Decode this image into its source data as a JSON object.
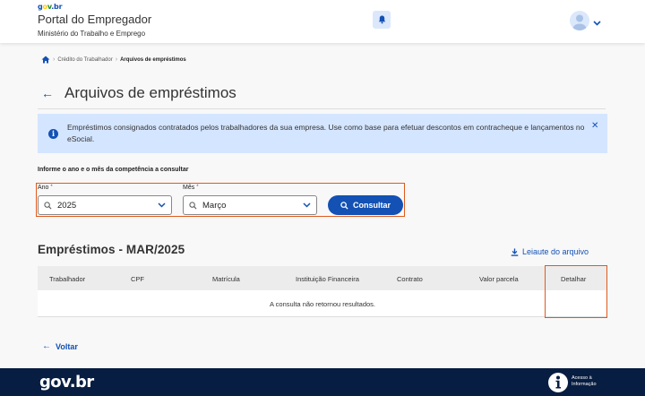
{
  "header": {
    "logo_small": {
      "g": "g",
      "o": "o",
      "v": "v",
      "b": ".br"
    },
    "title": "Portal do Empregador",
    "subtitle": "Ministério do Trabalho e Emprego",
    "bell_icon": "bell-icon",
    "avatar_icon": "user-avatar-icon"
  },
  "breadcrumb": {
    "home_icon": "home-icon",
    "items": [
      "Crédito do Trabalhador",
      "Arquivos de empréstimos"
    ]
  },
  "page": {
    "title": "Arquivos de empréstimos"
  },
  "alert": {
    "text": "Empréstimos consignados contratados pelos trabalhadores da sua empresa. Use como base para efetuar descontos em contracheque e lançamentos no eSocial.",
    "icon_glyph": "i",
    "close_glyph": "✕"
  },
  "filters": {
    "label": "Informe o ano e o mês da competência a consultar",
    "year": {
      "label": "Ano",
      "required_mark": "*",
      "value": "2025"
    },
    "month": {
      "label": "Mês",
      "required_mark": "*",
      "value": "Março"
    },
    "submit_label": "Consultar"
  },
  "results": {
    "title": "Empréstimos - MAR/2025",
    "layout_link": "Leiaute do arquivo",
    "columns": [
      "Trabalhador",
      "CPF",
      "Matrícula",
      "Instituição Financeira",
      "Contrato",
      "Valor parcela",
      "Detalhar"
    ],
    "empty_message": "A consulta não retornou resultados."
  },
  "back_link": "Voltar",
  "footer": {
    "logo": "gov.br",
    "access_label": "Acesso à Informação"
  },
  "colors": {
    "primary": "#1351b4",
    "footer_bg": "#071d41",
    "alert_bg": "#d4e5ff",
    "highlight": "#e05a1c"
  }
}
